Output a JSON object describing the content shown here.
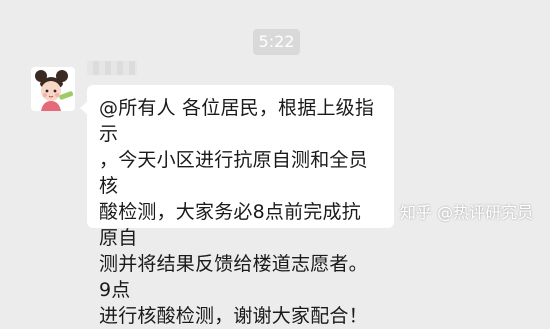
{
  "chat": {
    "timestamp": "5:22",
    "message": {
      "avatar_icon": "cartoon-girl-avatar-icon",
      "text_line1": "@所有人 各位居民，根据上级指示",
      "text_line2": "，今天小区进行抗原自测和全员核",
      "text_line3": "酸检测，大家务必8点前完成抗原自",
      "text_line4": "测并将结果反馈给楼道志愿者。9点",
      "text_line5": "进行核酸检测，谢谢大家配合！"
    }
  },
  "watermark": {
    "text": "知乎 @热评研究员"
  }
}
